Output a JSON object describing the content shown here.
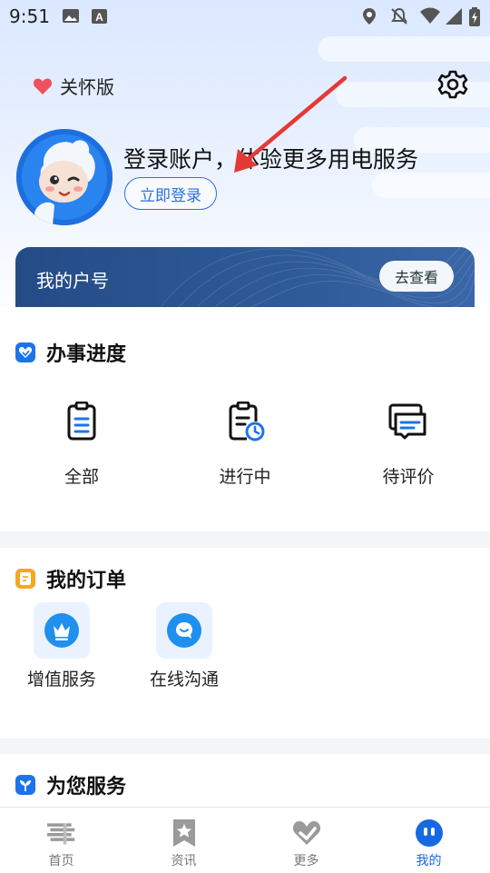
{
  "status_bar": {
    "time": "9:51"
  },
  "care_mode": {
    "label": "关怀版"
  },
  "profile": {
    "login_prompt": "登录账户，体验更多用电服务",
    "login_button": "立即登录"
  },
  "account_card": {
    "title": "我的户号",
    "view_button": "去查看"
  },
  "progress": {
    "title": "办事进度",
    "items": [
      {
        "label": "全部",
        "icon": "clipboard-list-icon"
      },
      {
        "label": "进行中",
        "icon": "clipboard-clock-icon"
      },
      {
        "label": "待评价",
        "icon": "message-stack-icon"
      }
    ]
  },
  "orders": {
    "title": "我的订单",
    "items": [
      {
        "label": "增值服务",
        "icon": "crown-icon"
      },
      {
        "label": "在线沟通",
        "icon": "chat-bubble-icon"
      }
    ]
  },
  "services": {
    "title": "为您服务"
  },
  "tab_bar": {
    "tabs": [
      {
        "label": "首页",
        "icon": "home-stack-icon"
      },
      {
        "label": "资讯",
        "icon": "bookmark-star-icon"
      },
      {
        "label": "更多",
        "icon": "heart-logo-icon"
      },
      {
        "label": "我的",
        "icon": "face-icon"
      }
    ],
    "active": "我的"
  },
  "colors": {
    "accent": "#1668e3",
    "card": "#244b86",
    "arrow": "#e53935"
  }
}
